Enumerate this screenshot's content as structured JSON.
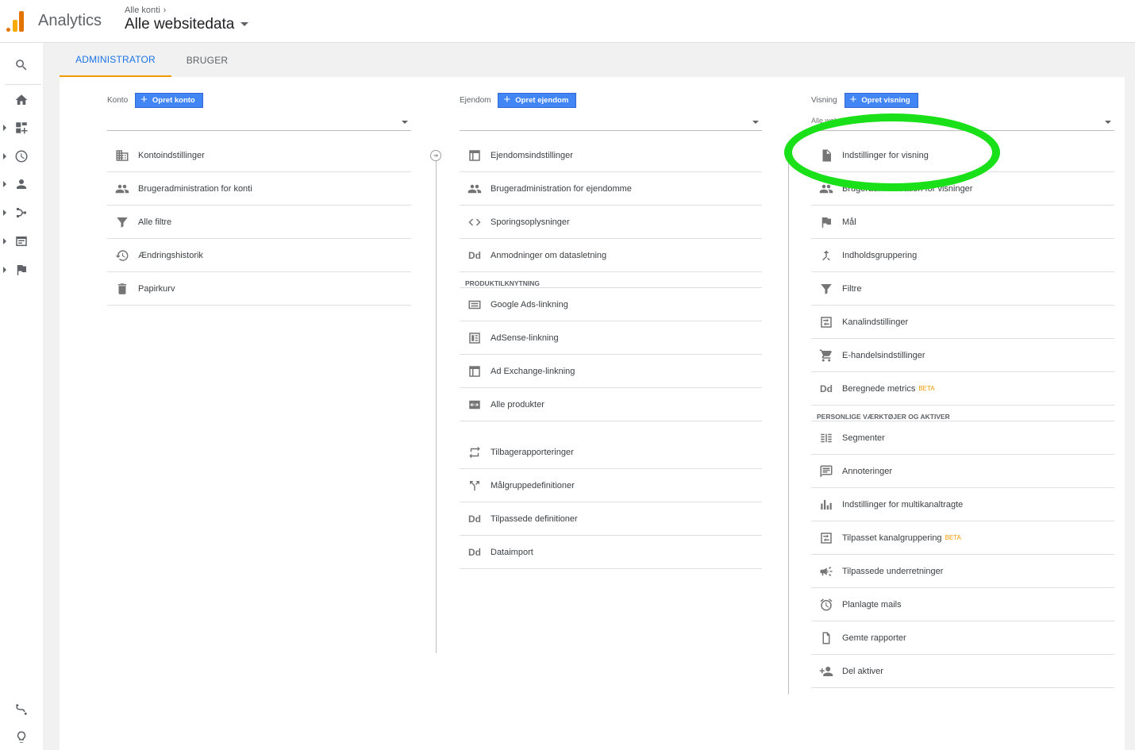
{
  "header": {
    "app_name": "Analytics",
    "breadcrumb": "Alle konti",
    "property_title": "Alle websitedata"
  },
  "tabs": [
    {
      "label": "ADMINISTRATOR"
    },
    {
      "label": "BRUGER"
    }
  ],
  "columns": {
    "account": {
      "label": "Konto",
      "create_button": "Opret konto",
      "selected": "",
      "items": [
        {
          "icon": "building-icon",
          "label": "Kontoindstillinger"
        },
        {
          "icon": "people-icon",
          "label": "Brugeradministration for konti"
        },
        {
          "icon": "filter-icon",
          "label": "Alle filtre"
        },
        {
          "icon": "history-icon",
          "label": "Ændringshistorik"
        },
        {
          "icon": "trash-icon",
          "label": "Papirkurv"
        }
      ]
    },
    "property": {
      "label": "Ejendom",
      "create_button": "Opret ejendom",
      "selected": "",
      "items": [
        {
          "icon": "window-icon",
          "label": "Ejendomsindstillinger"
        },
        {
          "icon": "people-icon",
          "label": "Brugeradministration for ejendomme"
        },
        {
          "icon": "code-icon",
          "label": "Sporingsoplysninger"
        },
        {
          "icon": "dd-icon",
          "label": "Anmodninger om datasletning"
        }
      ],
      "section_label": "PRODUKTILKNYTNING",
      "product_items": [
        {
          "icon": "ads-icon",
          "label": "Google Ads-linkning"
        },
        {
          "icon": "adsense-icon",
          "label": "AdSense-linkning"
        },
        {
          "icon": "window-icon",
          "label": "Ad Exchange-linkning"
        },
        {
          "icon": "link-icon",
          "label": "Alle produkter"
        }
      ],
      "more_items": [
        {
          "icon": "postback-icon",
          "label": "Tilbagerapporteringer"
        },
        {
          "icon": "fork-icon",
          "label": "Målgruppedefinitioner"
        },
        {
          "icon": "dd-icon",
          "label": "Tilpassede definitioner"
        },
        {
          "icon": "dd-icon",
          "label": "Dataimport"
        }
      ]
    },
    "view": {
      "label": "Visning",
      "create_button": "Opret visning",
      "selected": "Alle websitedata",
      "items": [
        {
          "icon": "document-icon",
          "label": "Indstillinger for visning"
        },
        {
          "icon": "people-icon",
          "label": "Brugeradministration for visninger"
        },
        {
          "icon": "flag-icon",
          "label": "Mål"
        },
        {
          "icon": "merge-icon",
          "label": "Indholdsgruppering"
        },
        {
          "icon": "filter-icon",
          "label": "Filtre"
        },
        {
          "icon": "channel-icon",
          "label": "Kanalindstillinger"
        },
        {
          "icon": "cart-icon",
          "label": "E-handelsindstillinger"
        },
        {
          "icon": "dd-icon",
          "label": "Beregnede metrics",
          "badge": "BETA"
        }
      ],
      "section_label": "PERSONLIGE VÆRKTØJER OG AKTIVER",
      "personal_items": [
        {
          "icon": "segment-icon",
          "label": "Segmenter"
        },
        {
          "icon": "comment-icon",
          "label": "Annoteringer"
        },
        {
          "icon": "bar-chart-icon",
          "label": "Indstillinger for multikanaltragte"
        },
        {
          "icon": "channel-icon",
          "label": "Tilpasset kanalgruppering",
          "badge": "BETA"
        },
        {
          "icon": "megaphone-icon",
          "label": "Tilpassede underretninger"
        },
        {
          "icon": "alarm-icon",
          "label": "Planlagte mails"
        },
        {
          "icon": "file-icon",
          "label": "Gemte rapporter"
        },
        {
          "icon": "add-person-icon",
          "label": "Del aktiver"
        }
      ]
    }
  },
  "highlight_color": "#19e019",
  "accent_color": "#1a73e8",
  "button_color": "#4285f4"
}
